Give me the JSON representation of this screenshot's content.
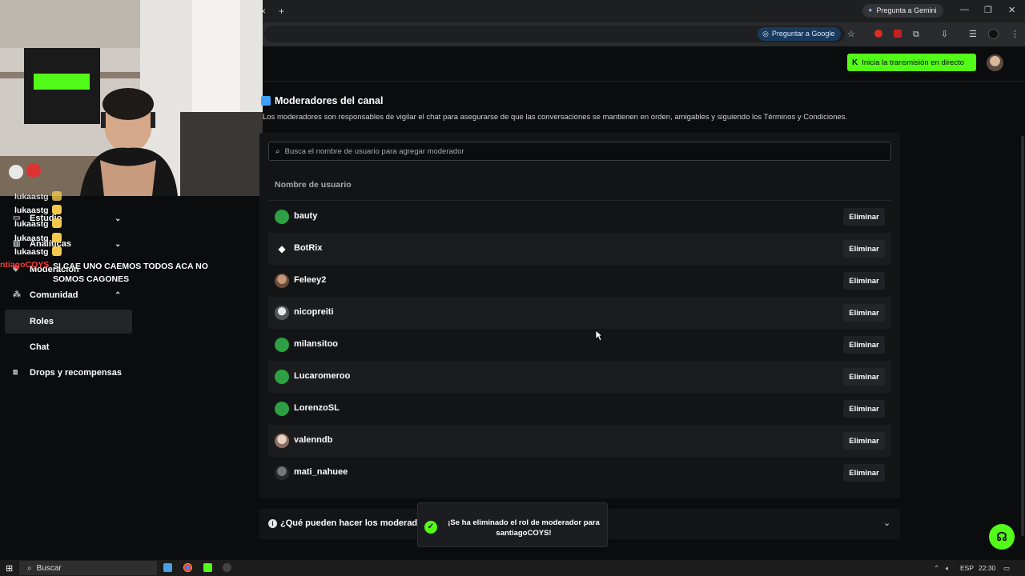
{
  "browser": {
    "gemini_label": "Pregunta a Gemini",
    "ask_google_label": "Preguntar a Google",
    "new_tab": "+",
    "close_tab": "×"
  },
  "header": {
    "live_button": "Inicia la transmisión en directo"
  },
  "sidebar": {
    "items": [
      {
        "label": "Estudio",
        "icon": "video-icon",
        "chevron": "⌄"
      },
      {
        "label": "Analíticas",
        "icon": "chart-icon",
        "chevron": "⌄"
      },
      {
        "label": "Moderación",
        "icon": "shield-icon",
        "chevron": ""
      },
      {
        "label": "Comunidad",
        "icon": "community-icon",
        "chevron": "⌃"
      },
      {
        "label": "Roles",
        "icon": "",
        "chevron": ""
      },
      {
        "label": "Chat",
        "icon": "",
        "chevron": ""
      },
      {
        "label": "Drops y recompensas",
        "icon": "gift-icon",
        "chevron": ""
      }
    ]
  },
  "chat_overlay": {
    "messages": [
      {
        "user": "lukaastg",
        "text": ""
      },
      {
        "user": "lukaastg",
        "text": ""
      },
      {
        "user": "lukaastg",
        "text": ""
      },
      {
        "user": "lukaastg",
        "text": ""
      },
      {
        "user": "lukaastg",
        "text": ""
      },
      {
        "user": "ntiagoCOYS",
        "text": "SI CAE UNO CAEMOS TODOS ACA NO SOMOS CAGONES"
      }
    ]
  },
  "moderators": {
    "title": "Moderadores del canal",
    "description": "Los moderadores son responsables de vigilar el chat para asegurarse de que las conversaciones se mantienen en orden, amigables y siguiendo los Términos y Condiciones.",
    "search_placeholder": "Busca el nombre de usuario para agregar moderador",
    "column_username": "Nombre de usuario",
    "delete_label": "Eliminar",
    "rows": [
      {
        "username": "bauty",
        "avatar": "green"
      },
      {
        "username": "BotRix",
        "avatar": "bot"
      },
      {
        "username": "Feleey2",
        "avatar": "photo-brown"
      },
      {
        "username": "nicopreiti",
        "avatar": "photo-gray"
      },
      {
        "username": "milansitoo",
        "avatar": "green"
      },
      {
        "username": "Lucaromeroo",
        "avatar": "green"
      },
      {
        "username": "LorenzoSL",
        "avatar": "green"
      },
      {
        "username": "valenndb",
        "avatar": "photo-light"
      },
      {
        "username": "mati_nahuee",
        "avatar": "photo-dark"
      }
    ]
  },
  "faq": {
    "label": "¿Qué pueden hacer los moderadores?",
    "visible_label": "¿Qué pueden hacer los moderado"
  },
  "toast": {
    "message": "¡Se ha eliminado el rol de moderador para santiagoCOYS!"
  },
  "taskbar": {
    "search_label": "Buscar",
    "language": "ESP",
    "time": "22:30"
  },
  "colors": {
    "kick_green": "#53fc18",
    "bg": "#0b0c0d",
    "panel": "#131416",
    "row_alt": "#1a1c1e"
  }
}
